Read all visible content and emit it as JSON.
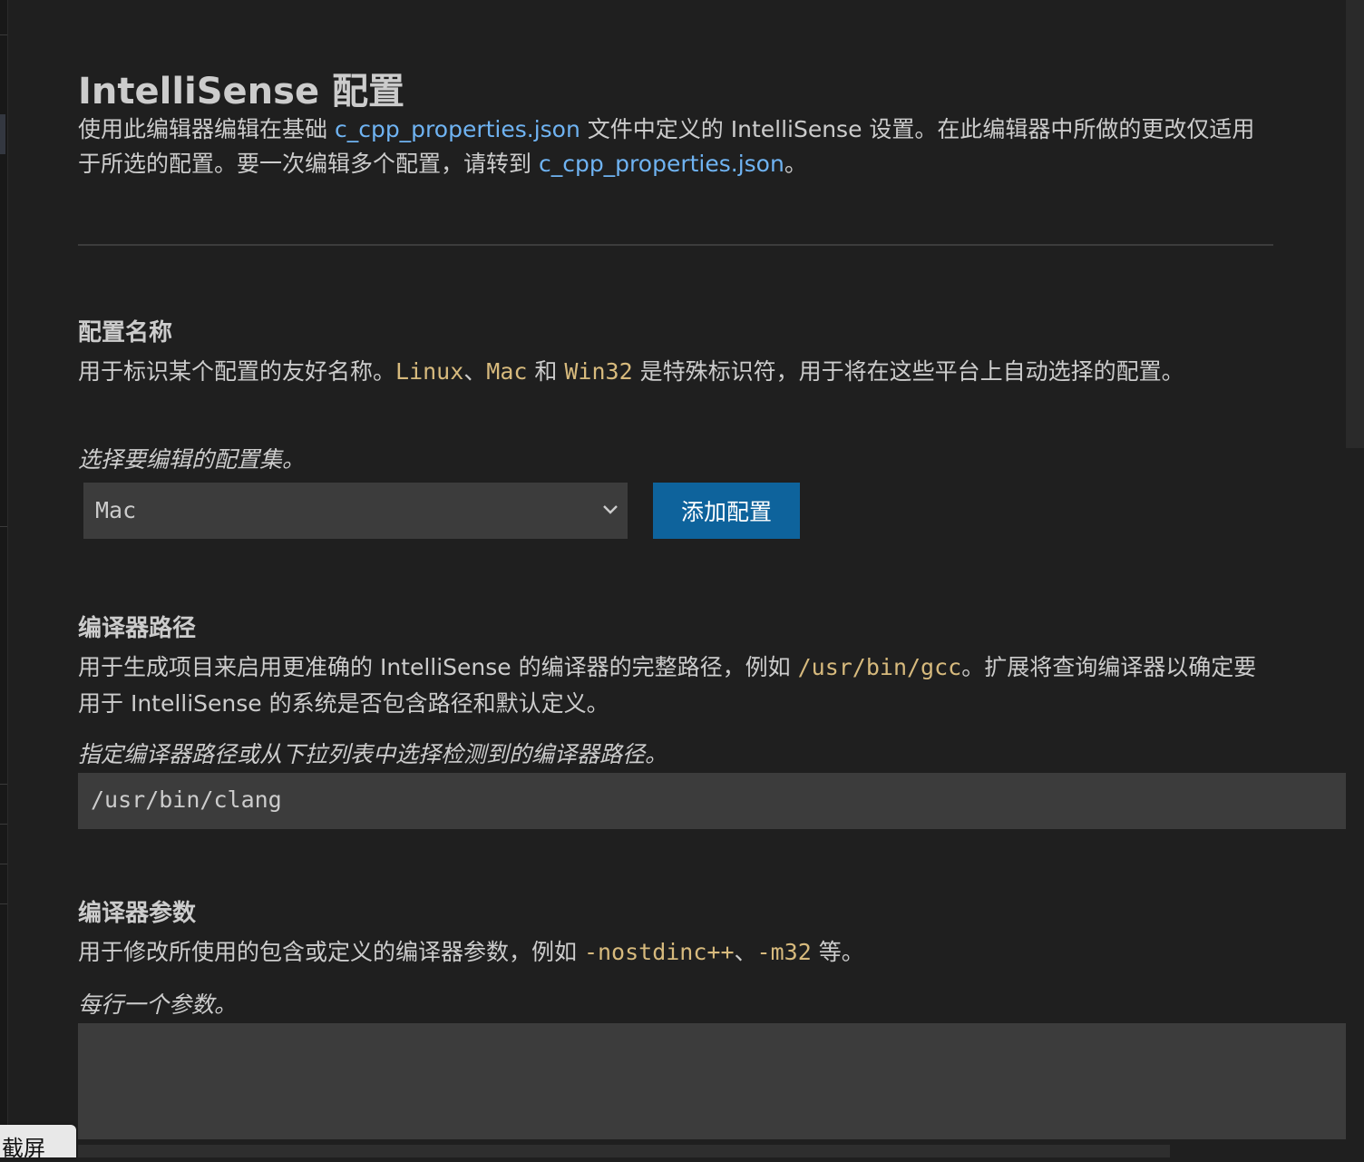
{
  "header": {
    "title": "IntelliSense 配置",
    "intro_before": "使用此编辑器编辑在基础 ",
    "intro_link_1": "c_cpp_properties.json",
    "intro_middle": " 文件中定义的 IntelliSense 设置。在此编辑器中所做的更改仅适用于所选的配置。要一次编辑多个配置，请转到 ",
    "intro_link_2": "c_cpp_properties.json",
    "intro_after": "。"
  },
  "config_name": {
    "title": "配置名称",
    "desc_1": "用于标识某个配置的友好名称。",
    "code_linux": "Linux",
    "sep_1": "、",
    "code_mac": "Mac",
    "sep_2": " 和 ",
    "code_win32": "Win32",
    "desc_2": " 是特殊标识符，用于将在这些平台上自动选择的配置。",
    "hint": "选择要编辑的配置集。",
    "selected": "Mac",
    "add_button": "添加配置"
  },
  "compiler_path": {
    "title": "编译器路径",
    "desc_1": "用于生成项目来启用更准确的 IntelliSense 的编译器的完整路径，例如 ",
    "code_example": "/usr/bin/gcc",
    "desc_2": "。扩展将查询编译器以确定要用于 IntelliSense 的系统是否包含路径和默认定义。",
    "hint": "指定编译器路径或从下拉列表中选择检测到的编译器路径。",
    "value": "/usr/bin/clang"
  },
  "compiler_args": {
    "title": "编译器参数",
    "desc_1": "用于修改所使用的包含或定义的编译器参数，例如 ",
    "code_1": "-nostdinc++",
    "sep": "、",
    "code_2": "-m32",
    "desc_2": " 等。",
    "hint": "每行一个参数。",
    "value": ""
  },
  "tooltip": {
    "label": "截屏"
  },
  "colors": {
    "background": "#1f1f1f",
    "link": "#6fb3f2",
    "code": "#d7ba7d",
    "button": "#0e639c",
    "input": "#3c3c3c"
  }
}
